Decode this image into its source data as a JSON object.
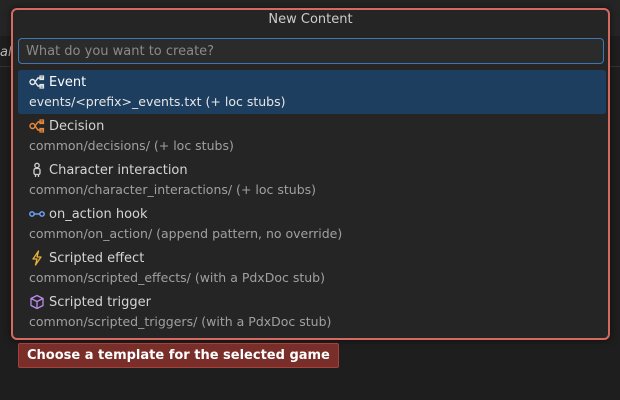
{
  "background": {
    "left_fragment": "al",
    "right_fragment": ""
  },
  "quickpick": {
    "title": "New Content",
    "input_placeholder": "What do you want to create?",
    "items": [
      {
        "label": "Event",
        "detail": "events/<prefix>_events.txt (+ loc stubs)",
        "icon": "event-icon",
        "selected": true
      },
      {
        "label": "Decision",
        "detail": "common/decisions/ (+ loc stubs)",
        "icon": "decision-icon",
        "selected": false
      },
      {
        "label": "Character interaction",
        "detail": "common/character_interactions/ (+ loc stubs)",
        "icon": "character-icon",
        "selected": false
      },
      {
        "label": "on_action hook",
        "detail": "common/on_action/ (append pattern, no override)",
        "icon": "hook-icon",
        "selected": false
      },
      {
        "label": "Scripted effect",
        "detail": "common/scripted_effects/ (with a PdxDoc stub)",
        "icon": "lightning-icon",
        "selected": false
      },
      {
        "label": "Scripted trigger",
        "detail": "common/scripted_triggers/ (with a PdxDoc stub)",
        "icon": "cube-icon",
        "selected": false
      }
    ]
  },
  "tooltip": {
    "text": "Choose a template for the selected game"
  },
  "colors": {
    "accent_border": "#d66a60",
    "selection": "#1d3e5f",
    "tooltip_bg": "#7a2e2a"
  }
}
